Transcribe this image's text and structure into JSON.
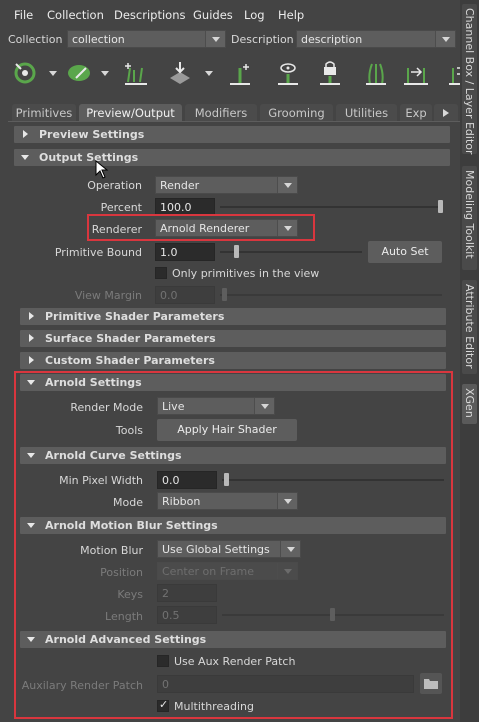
{
  "menu": [
    "File",
    "Collection",
    "Descriptions",
    "Guides",
    "Log",
    "Help"
  ],
  "collection": {
    "label": "Collection",
    "value": "collection"
  },
  "description": {
    "label": "Description",
    "value": "description"
  },
  "tabs": [
    "Primitives",
    "Preview/Output",
    "Modifiers",
    "Grooming",
    "Utilities",
    "Exp"
  ],
  "side_tabs": [
    "Channel Box / Layer Editor",
    "Modeling Toolkit",
    "Attribute Editor",
    "XGen"
  ],
  "preview_settings": "Preview Settings",
  "output_settings": {
    "title": "Output Settings",
    "operation_label": "Operation",
    "operation_value": "Render",
    "percent_label": "Percent",
    "percent_value": "100.0",
    "percent_fraction": 1.0,
    "renderer_label": "Renderer",
    "renderer_value": "Arnold Renderer",
    "primitive_bound_label": "Primitive Bound",
    "primitive_bound_value": "1.0",
    "auto_set": "Auto Set",
    "only_primitives": "Only primitives in the view",
    "view_margin_label": "View Margin",
    "view_margin_value": "0.0"
  },
  "primitive_shader": "Primitive Shader Parameters",
  "surface_shader": "Surface Shader Parameters",
  "custom_shader": "Custom Shader Parameters",
  "arnold_settings": {
    "title": "Arnold Settings",
    "render_mode_label": "Render Mode",
    "render_mode_value": "Live",
    "tools_label": "Tools",
    "apply_hair_shader": "Apply Hair Shader"
  },
  "arnold_curve": {
    "title": "Arnold Curve Settings",
    "min_pixel_width_label": "Min Pixel Width",
    "min_pixel_width_value": "0.0",
    "mode_label": "Mode",
    "mode_value": "Ribbon"
  },
  "arnold_motion_blur": {
    "title": "Arnold Motion Blur Settings",
    "motion_blur_label": "Motion Blur",
    "motion_blur_value": "Use Global Settings",
    "position_label": "Position",
    "position_value": "Center on Frame",
    "keys_label": "Keys",
    "keys_value": "2",
    "length_label": "Length",
    "length_value": "0.5"
  },
  "arnold_advanced": {
    "title": "Arnold Advanced Settings",
    "use_aux_label": "Use Aux Render Patch",
    "aux_patch_label": "Auxilary Render Patch",
    "aux_patch_value": "0",
    "multithreading_label": "Multithreading"
  },
  "colors": {
    "highlight": "#d9363e",
    "tool_green": "#5aa64b"
  }
}
